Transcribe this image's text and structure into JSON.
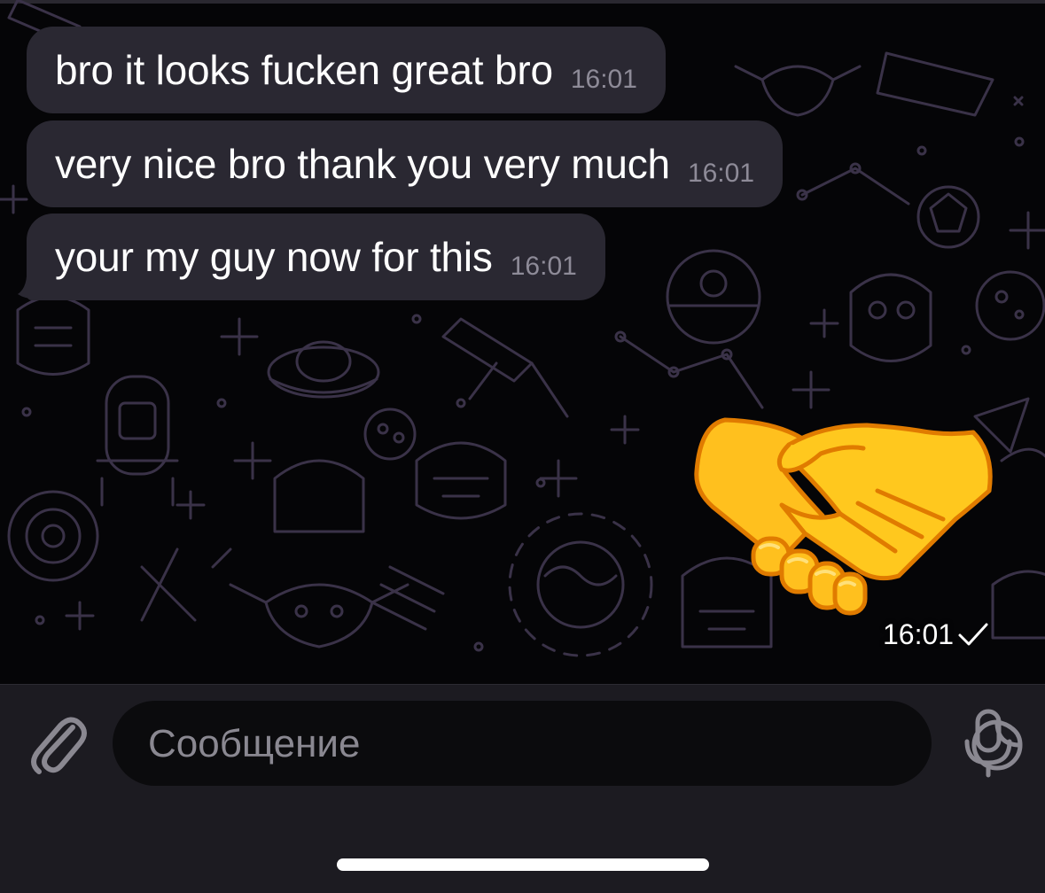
{
  "messages": [
    {
      "text": "bro it looks fucken great bro",
      "time": "16:01"
    },
    {
      "text": "very nice bro thank you very much",
      "time": "16:01"
    },
    {
      "text": "your my guy now for this",
      "time": "16:01"
    }
  ],
  "sticker": {
    "emoji": "handshake-icon",
    "time": "16:01",
    "status": "sent-check-icon"
  },
  "composer": {
    "placeholder": "Сообщение"
  },
  "colors": {
    "background": "#050507",
    "bubble": "#2a2832",
    "composer": "#1c1b21",
    "input": "#0b0b0d",
    "pattern": "#3a3248",
    "handshake": "#fcc419"
  }
}
